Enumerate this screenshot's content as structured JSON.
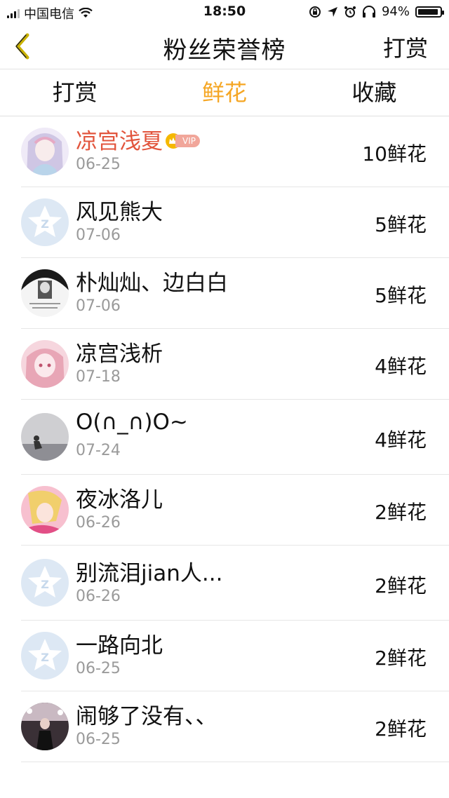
{
  "status": {
    "carrier": "中国电信",
    "time": "18:50",
    "battery": "94%",
    "battery_level": 0.94
  },
  "nav": {
    "title": "粉丝荣誉榜",
    "right_label": "打赏"
  },
  "tabs": [
    {
      "label": "打赏",
      "active": false
    },
    {
      "label": "鲜花",
      "active": true
    },
    {
      "label": "收藏",
      "active": false
    }
  ],
  "colors": {
    "accent": "#f5a623",
    "highlight_name": "#e2553d"
  },
  "list": [
    {
      "name": "凉宫浅夏",
      "date": "06-25",
      "count": "10鲜花",
      "avatar": "anime-girl-lavender",
      "vip": "VIP"
    },
    {
      "name": "风见熊大",
      "date": "07-06",
      "count": "5鲜花",
      "avatar": "default-star"
    },
    {
      "name": "朴灿灿、边白白",
      "date": "07-06",
      "count": "5鲜花",
      "avatar": "bw-photo"
    },
    {
      "name": "凉宫浅析",
      "date": "07-18",
      "count": "4鲜花",
      "avatar": "anime-girl-pink"
    },
    {
      "name": "O(∩_∩)O~",
      "date": "07-24",
      "count": "4鲜花",
      "avatar": "grey-room"
    },
    {
      "name": "夜冰洛儿",
      "date": "06-26",
      "count": "2鲜花",
      "avatar": "anime-blonde"
    },
    {
      "name": "别流泪jian人...",
      "date": "06-26",
      "count": "2鲜花",
      "avatar": "default-star"
    },
    {
      "name": "一路向北",
      "date": "06-25",
      "count": "2鲜花",
      "avatar": "default-star"
    },
    {
      "name": "闹够了没有、、",
      "date": "06-25",
      "count": "2鲜花",
      "avatar": "dark-photo"
    }
  ]
}
